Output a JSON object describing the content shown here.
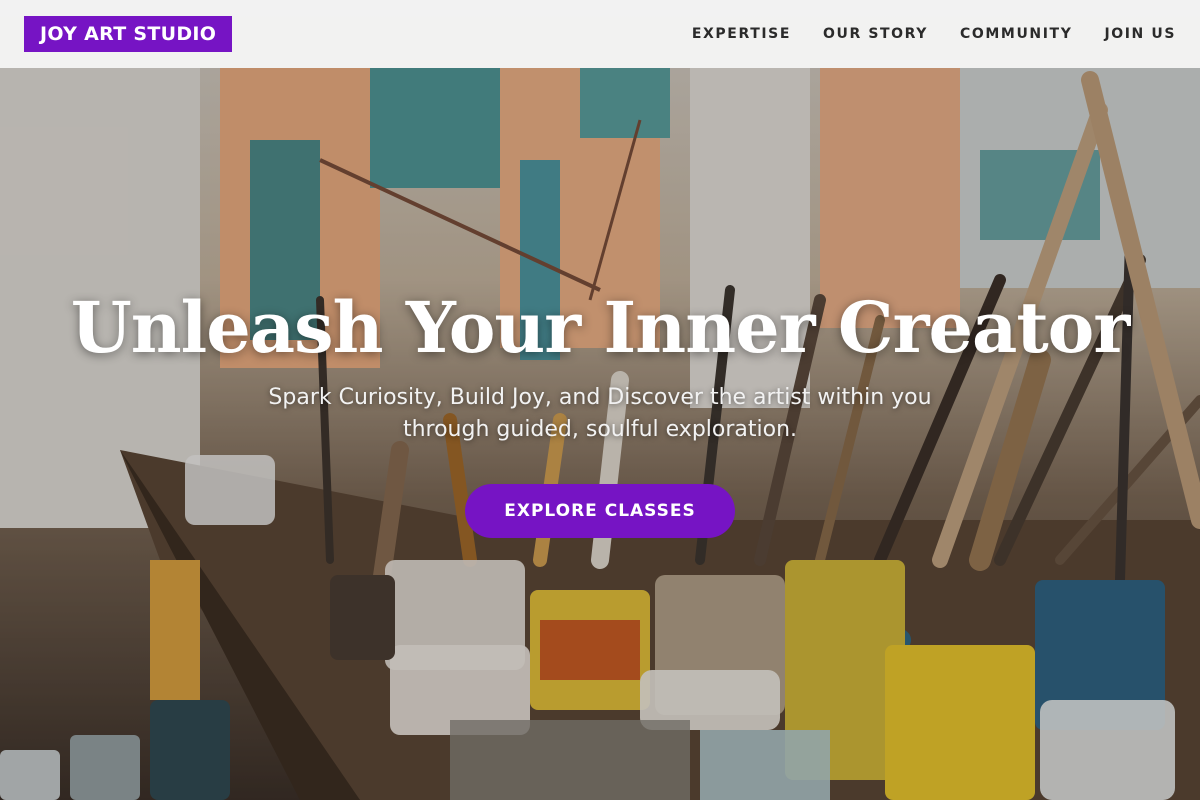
{
  "navbar": {
    "logo": "JOY ART STUDIO",
    "links": [
      {
        "label": "EXPERTISE"
      },
      {
        "label": "OUR STORY"
      },
      {
        "label": "COMMUNITY"
      },
      {
        "label": "JOIN US"
      }
    ]
  },
  "hero": {
    "title": "Unleash Your Inner Creator",
    "subtitle": "Spark Curiosity, Build Joy, and Discover the artist within you through guided, soulful exploration.",
    "cta_label": "EXPLORE CLASSES"
  },
  "colors": {
    "accent": "#7614c4",
    "navbar_bg": "#f8f8f8",
    "hero_text": "#ffffff"
  }
}
